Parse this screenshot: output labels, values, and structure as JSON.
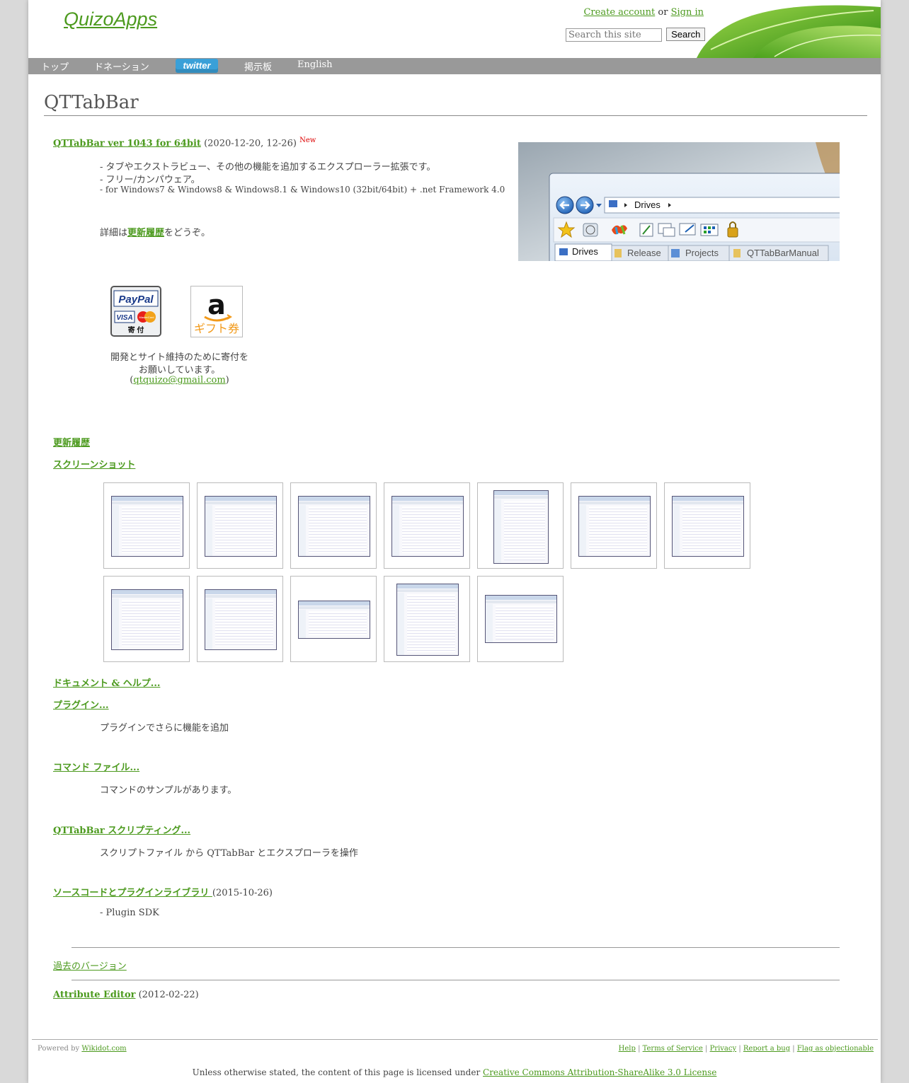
{
  "header": {
    "site_title": "QuizoApps",
    "create_account": "Create account",
    "or": "or",
    "sign_in": "Sign in",
    "search_placeholder": "Search this site",
    "search_button": "Search"
  },
  "nav": {
    "top": "トップ",
    "donation": "ドネーション",
    "twitter": "twitter",
    "board": "掲示板",
    "english": "English"
  },
  "page_title": "QTTabBar",
  "release": {
    "link": "QTTabBar ver 1043 for 64bit",
    "date": "(2020-12-20, 12-26)",
    "new": "New",
    "desc1": "- タブやエクストラビュー、その他の機能を追加するエクスプローラー拡張です。",
    "desc2": "- フリー/カンパウェア。",
    "desc3": "- for Windows7 & Windows8 & Windows8.1 & Windows10 (32bit/64bit) + .net Framework 4.0",
    "details_pre": "詳細は",
    "details_link": "更新履歴",
    "details_post": "をどうぞ。"
  },
  "screenshot_main": {
    "address": "Drives",
    "tabs": [
      "Drives",
      "Release",
      "Projects",
      "QTTabBarManual"
    ]
  },
  "donate": {
    "paypal_text": "PayPal",
    "paypal_visa": "VISA",
    "paypal_mc": "MasterCard",
    "paypal_kifu": "寄 付",
    "amazon_letter": "a",
    "amazon_text": "ギフト券",
    "msg1": "開発とサイト維持のために寄付を",
    "msg2": "お願いしています。",
    "email_pre": "(",
    "email": "qtquizo@gmail.com",
    "email_post": ")"
  },
  "sections": {
    "history": "更新履歴",
    "screenshots": "スクリーンショット",
    "docs": "ドキュメント & ヘルプ...",
    "plugins": "プラグイン...",
    "plugins_desc": "プラグインでさらに機能を追加",
    "commands": "コマンド ファイル...",
    "commands_desc": "コマンドのサンプルがあります。",
    "scripting": "QTTabBar スクリプティング...",
    "scripting_desc": "スクリプトファイル から QTTabBar とエクスプローラを操作",
    "source": "ソースコードとプラグインライブラリ ",
    "source_date": "(2015-10-26)",
    "source_desc": "- Plugin SDK",
    "old_versions": "過去のバージョン",
    "attribute_editor": "Attribute Editor",
    "attribute_date": "(2012-02-22)"
  },
  "footer": {
    "powered_by": "Powered by",
    "wikidot": "Wikidot.com",
    "help": "Help",
    "terms": "Terms of Service",
    "privacy": "Privacy",
    "report": "Report a bug",
    "flag": "Flag as objectionable",
    "license_pre": "Unless otherwise stated, the content of this page is licensed under",
    "license_link": "Creative Commons Attribution-ShareAlike 3.0 License"
  },
  "colors": {
    "link": "#4c9a1e",
    "nav": "#999999",
    "new": "#dd0000"
  }
}
